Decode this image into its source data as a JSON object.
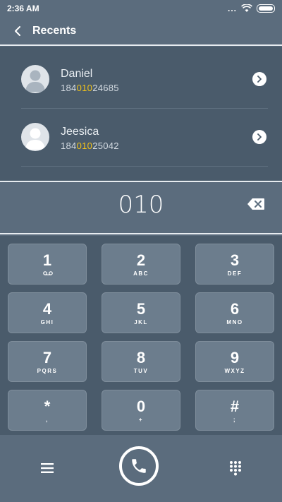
{
  "status": {
    "time": "2:36 AM",
    "dots": "..."
  },
  "header": {
    "title": "Recents"
  },
  "recents": [
    {
      "name": "Daniel",
      "number_pre": "184",
      "number_match": "010",
      "number_post": "24685"
    },
    {
      "name": "Jeesica",
      "number_pre": "184",
      "number_match": "010",
      "number_post": "25042"
    }
  ],
  "entry": {
    "digits": "010"
  },
  "keys": [
    {
      "digit": "1",
      "sub": ""
    },
    {
      "digit": "2",
      "sub": "ABC"
    },
    {
      "digit": "3",
      "sub": "DEF"
    },
    {
      "digit": "4",
      "sub": "GHI"
    },
    {
      "digit": "5",
      "sub": "JKL"
    },
    {
      "digit": "6",
      "sub": "MNO"
    },
    {
      "digit": "7",
      "sub": "PQRS"
    },
    {
      "digit": "8",
      "sub": "TUV"
    },
    {
      "digit": "9",
      "sub": "WXYZ"
    },
    {
      "digit": "*",
      "sub": ","
    },
    {
      "digit": "0",
      "sub": "+"
    },
    {
      "digit": "#",
      "sub": ";"
    }
  ],
  "colors": {
    "highlight": "#f2c319",
    "background": "#58697a",
    "key": "#6c7d8d"
  }
}
